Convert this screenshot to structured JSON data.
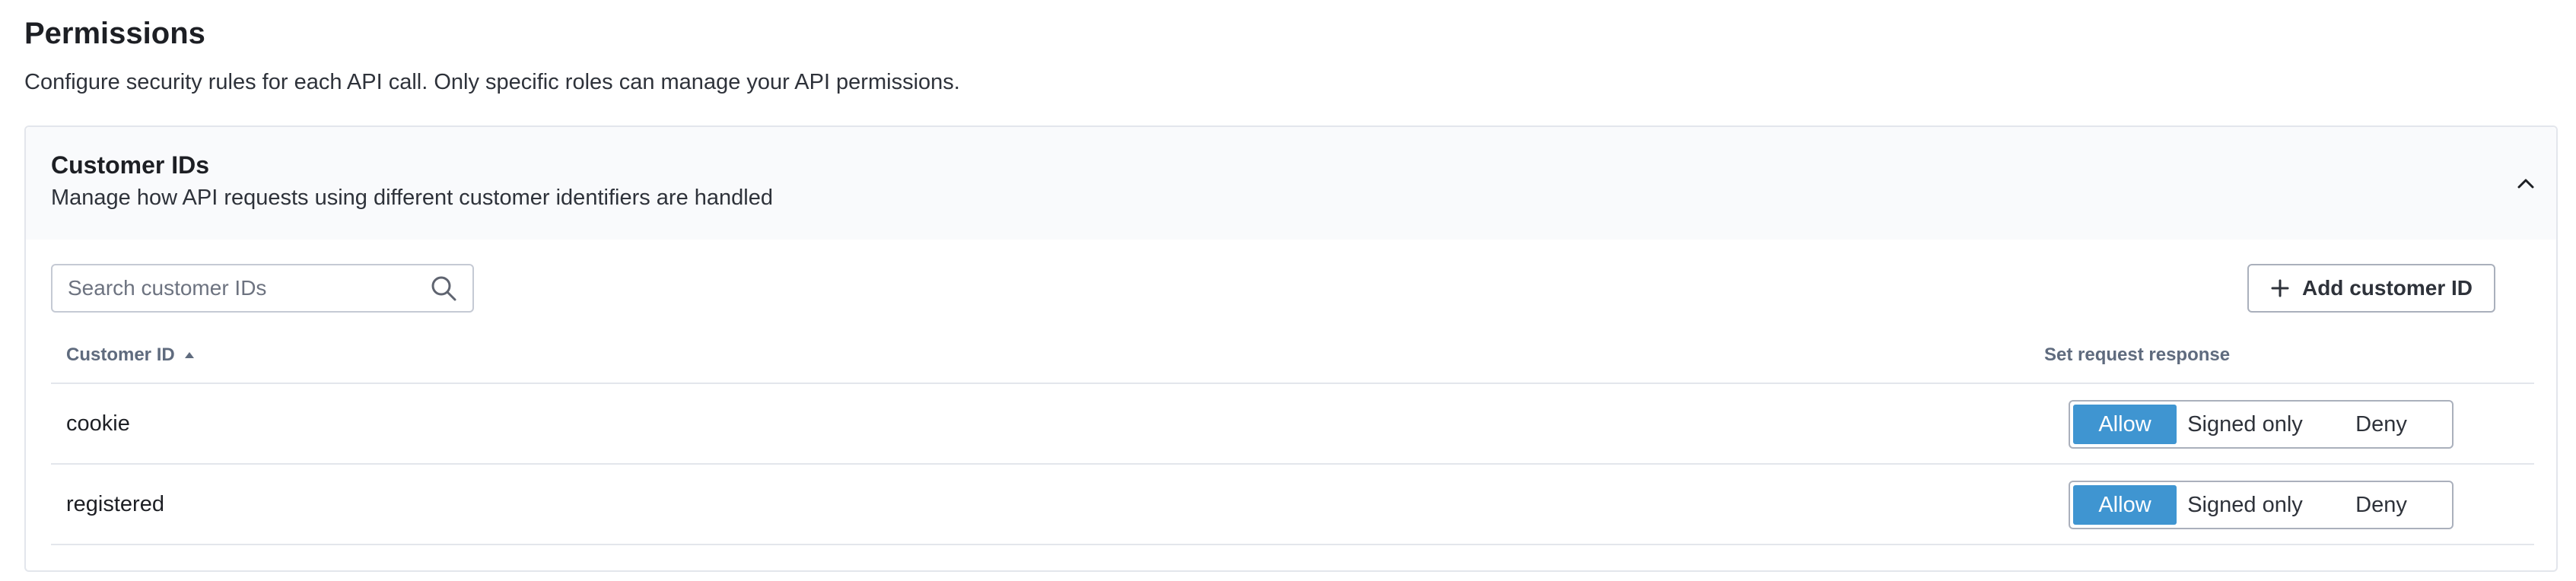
{
  "page": {
    "title": "Permissions",
    "description": "Configure security rules for each API call. Only specific roles can manage your API permissions."
  },
  "panel": {
    "title": "Customer IDs",
    "subtitle": "Manage how API requests using different customer identifiers are handled",
    "expanded": true,
    "collapse_icon": "chevron-up-icon"
  },
  "search": {
    "placeholder": "Search customer IDs",
    "value": "",
    "icon": "search-icon"
  },
  "add_button": {
    "label": "Add customer ID",
    "icon": "plus-icon"
  },
  "table": {
    "columns": [
      {
        "label": "Customer ID",
        "sort": "ascending",
        "sort_icon": "sort-up-icon"
      },
      {
        "label": "Set request response"
      }
    ],
    "options": [
      "Allow",
      "Signed only",
      "Deny"
    ],
    "rows": [
      {
        "customer_id": "cookie",
        "response": "Allow"
      },
      {
        "customer_id": "registered",
        "response": "Allow"
      }
    ]
  },
  "colors": {
    "accent": "#3f95d1",
    "border": "#e3e6ec",
    "header_bg": "#f9fafc",
    "text": "#1d1f24",
    "muted_header": "#5f6b7e"
  }
}
